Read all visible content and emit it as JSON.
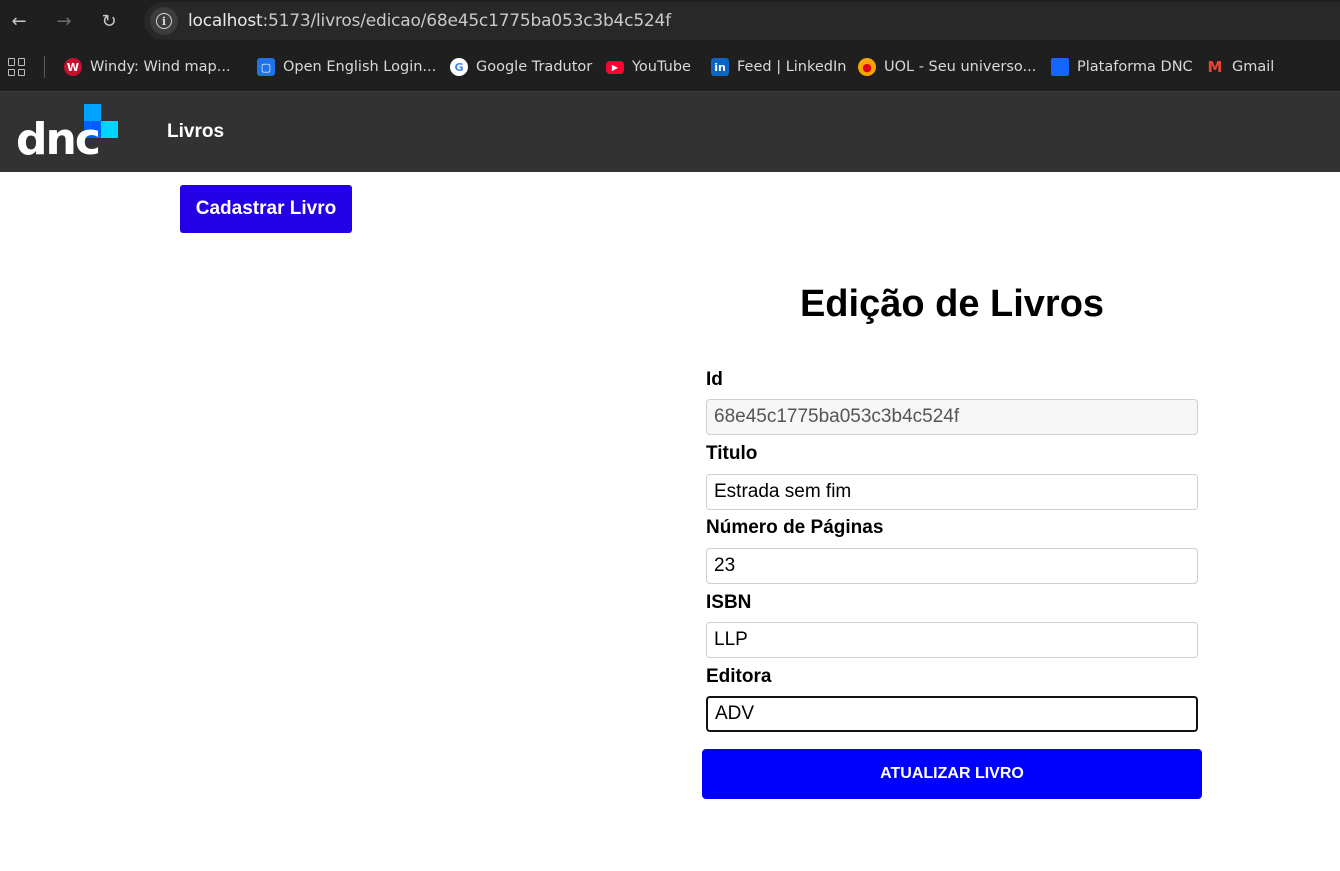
{
  "browser": {
    "url_host": "localhost",
    "url_path": ":5173/livros/edicao/68e45c1775ba053c3b4c524f",
    "bookmarks": [
      {
        "label": "Windy: Wind map...",
        "icon": "windy-icon",
        "color": "#c8102e"
      },
      {
        "label": "Open English Login...",
        "icon": "openenglish-icon",
        "color": "#1e73e8"
      },
      {
        "label": "Google Tradutor",
        "icon": "google-icon",
        "color": "#ffffff"
      },
      {
        "label": "YouTube",
        "icon": "youtube-icon",
        "color": "#ff0033"
      },
      {
        "label": "Feed | LinkedIn",
        "icon": "linkedin-icon",
        "color": "#0a66c2"
      },
      {
        "label": "UOL - Seu universo...",
        "icon": "uol-icon",
        "color": "#f7a600"
      },
      {
        "label": "Plataforma DNC",
        "icon": "dnc-icon",
        "color": "#1565ff"
      },
      {
        "label": "Gmail",
        "icon": "gmail-icon",
        "color": "#ea4335"
      }
    ]
  },
  "header": {
    "logo_text": "dnc",
    "nav_link": "Livros"
  },
  "main": {
    "register_button": "Cadastrar Livro",
    "title": "Edição de Livros",
    "fields": {
      "id": {
        "label": "Id",
        "value": "68e45c1775ba053c3b4c524f"
      },
      "titulo": {
        "label": "Titulo",
        "value": "Estrada sem fim"
      },
      "paginas": {
        "label": "Número de Páginas",
        "value": "23"
      },
      "isbn": {
        "label": "ISBN",
        "value": "LLP"
      },
      "editora": {
        "label": "Editora",
        "value": "ADV"
      }
    },
    "submit_button": "ATUALIZAR LIVRO"
  },
  "colors": {
    "register_button_bg": "#2300e6",
    "submit_button_bg": "#0000ff",
    "header_bg": "#323232"
  }
}
